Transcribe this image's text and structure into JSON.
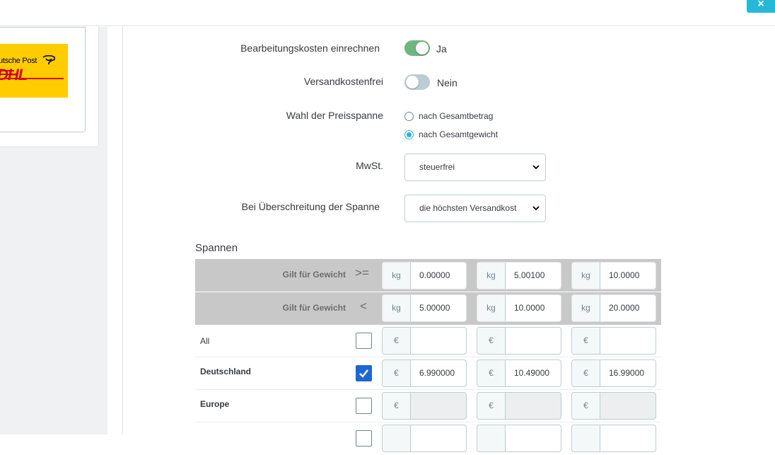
{
  "close_icon": "close-icon",
  "left_logo": {
    "post_text": "utsche Post",
    "dhl_text": "DHL",
    "brand_yellow": "#ffcc00",
    "brand_red": "#d40511"
  },
  "form": {
    "handling": {
      "label": "Bearbeitungskosten einrechnen",
      "state": "Ja"
    },
    "free_shipping": {
      "label": "Versandkostenfrei",
      "state": "Nein"
    },
    "range_choice": {
      "label": "Wahl der Preisspanne",
      "options": [
        "nach Gesamtbetrag",
        "nach Gesamtgewicht"
      ],
      "selected": "nach Gesamtgewicht"
    },
    "tax": {
      "label": "MwSt.",
      "value": "steuerfrei"
    },
    "out_of_range": {
      "label": "Bei Überschreitung der Spanne",
      "value": "die höchsten Versandkost"
    }
  },
  "ranges": {
    "title": "Spannen",
    "from_row": {
      "label": "Gilt für Gewicht",
      "op": ">=",
      "unit": "kg",
      "values": [
        "0.00000",
        "5.00100",
        "10.0000"
      ]
    },
    "to_row": {
      "label": "Gilt für Gewicht",
      "op": "<",
      "unit": "kg",
      "values": [
        "5.00000",
        "10.0000",
        "20.0000"
      ]
    },
    "currency": "€",
    "zones": [
      {
        "name": "All",
        "checked": false,
        "values": [
          "",
          "",
          ""
        ]
      },
      {
        "name": "Deutschland",
        "checked": true,
        "values": [
          "6.990000",
          "10.49000",
          "16.99000"
        ]
      },
      {
        "name": "Europe",
        "checked": false,
        "values": [
          "",
          "",
          ""
        ]
      }
    ]
  },
  "colors": {
    "accent": "#25b9d7",
    "switch_on": "#70b580",
    "checkbox": "#1f66d1"
  }
}
